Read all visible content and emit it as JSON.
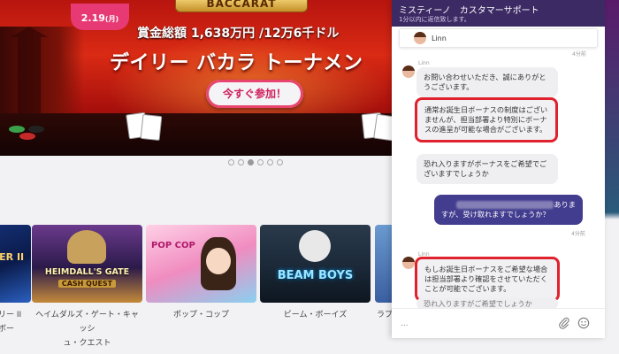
{
  "banner": {
    "date": "2.19",
    "date_weekday": "(月)",
    "baccarat_plate": "BACCARAT",
    "prize": "賞金総額 1,638万円 /12万6千ドル",
    "title": "デイリー バカラ トーナメン",
    "title_tail": "ト",
    "join_button": "今すぐ参加！"
  },
  "carousel": {
    "dots": 6,
    "active_index": 2
  },
  "games": [
    {
      "label": "リー II ボー",
      "tile_text": "DER II",
      "color": "#1a3c8a"
    },
    {
      "label": "ヘイムダルズ・ゲート・キャッシュ・クエスト",
      "label_l1": "ヘイムダルズ・ゲート・キャッシ",
      "label_l2": "ュ・クエスト",
      "tile_text": "HEIMDALL'S GATE",
      "tile_sub": "CASH QUEST",
      "color": "#2b1a4a"
    },
    {
      "label": "ポップ・コップ",
      "tile_text": "POP COP",
      "color": "#f08cc0"
    },
    {
      "label": "ビーム・ボーイズ",
      "tile_text": "BEAM BOYS",
      "color": "#1c2a3a"
    },
    {
      "label": "ラプ",
      "tile_text": "",
      "color": "#3a5fa0"
    }
  ],
  "chat": {
    "header_title": "ミスティーノ　カスタマーサポート",
    "header_sub": "1分以内に返信致します。",
    "agent_name": "Linn",
    "top_time": "4分前",
    "messages": [
      {
        "sender": "Linn",
        "text": "お問い合わせいただき、誠にありがとうございます。"
      },
      {
        "sender": "",
        "text": "通常お誕生日ボーナスの制度はございませんが、担当部署より特別にボーナスの進呈が可能な場合がございます。",
        "highlighted": true
      },
      {
        "sender": "",
        "text": "恐れ入りますがボーナスをご希望でございますでしょうか"
      }
    ],
    "user_message": {
      "prefix": "",
      "suffix1": "ありま",
      "suffix2": "すが、受け取れますでしょうか？",
      "time": "4分前"
    },
    "reply": {
      "sender": "Linn",
      "text": "もしお誕生日ボーナスをご希望な場合は担当部署より確認をさせていただくことが可能でございます。",
      "highlighted": true,
      "trailing": "恐れ入りますがご希望でしょうか"
    },
    "composer_placeholder": "..."
  }
}
